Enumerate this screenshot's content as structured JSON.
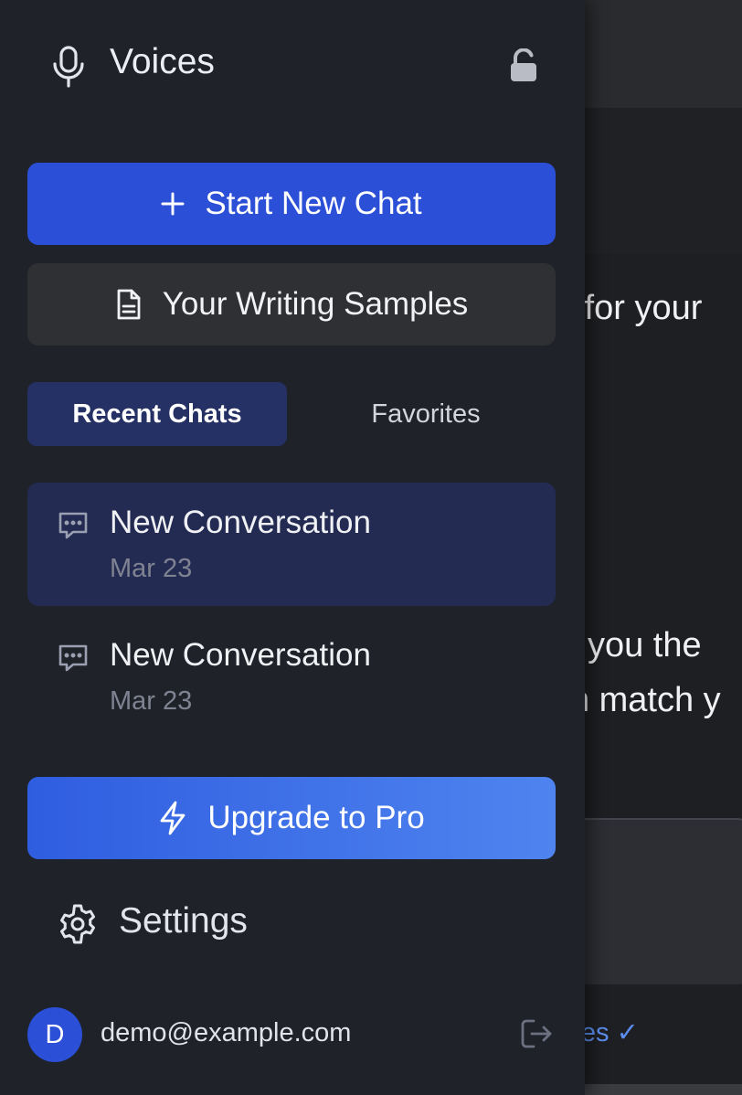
{
  "background": {
    "visible_line_1": "s for your",
    "visible_line_2": "e you the",
    "visible_line_3": "n match y",
    "writing_samples_link": "samples ✓"
  },
  "sidebar": {
    "title": "Voices",
    "title_icon": "microphone-icon",
    "lock_icon": "unlock-icon",
    "start_new_chat": "Start New Chat",
    "writing_samples": "Your Writing Samples",
    "tabs": [
      {
        "label": "Recent Chats",
        "active": true
      },
      {
        "label": "Favorites",
        "active": false
      }
    ],
    "conversations": [
      {
        "title": "New Conversation",
        "date": "Mar 23",
        "active": true
      },
      {
        "title": "New Conversation",
        "date": "Mar 23",
        "active": false
      }
    ],
    "upgrade": "Upgrade to Pro",
    "settings": "Settings",
    "account": {
      "avatar_letter": "D",
      "email": "demo@example.com"
    }
  },
  "colors": {
    "sidebar_bg": "#1f2229",
    "primary": "#2b4fd6",
    "active_tab": "#253164",
    "active_item": "#232b52",
    "link": "#5b8def"
  }
}
